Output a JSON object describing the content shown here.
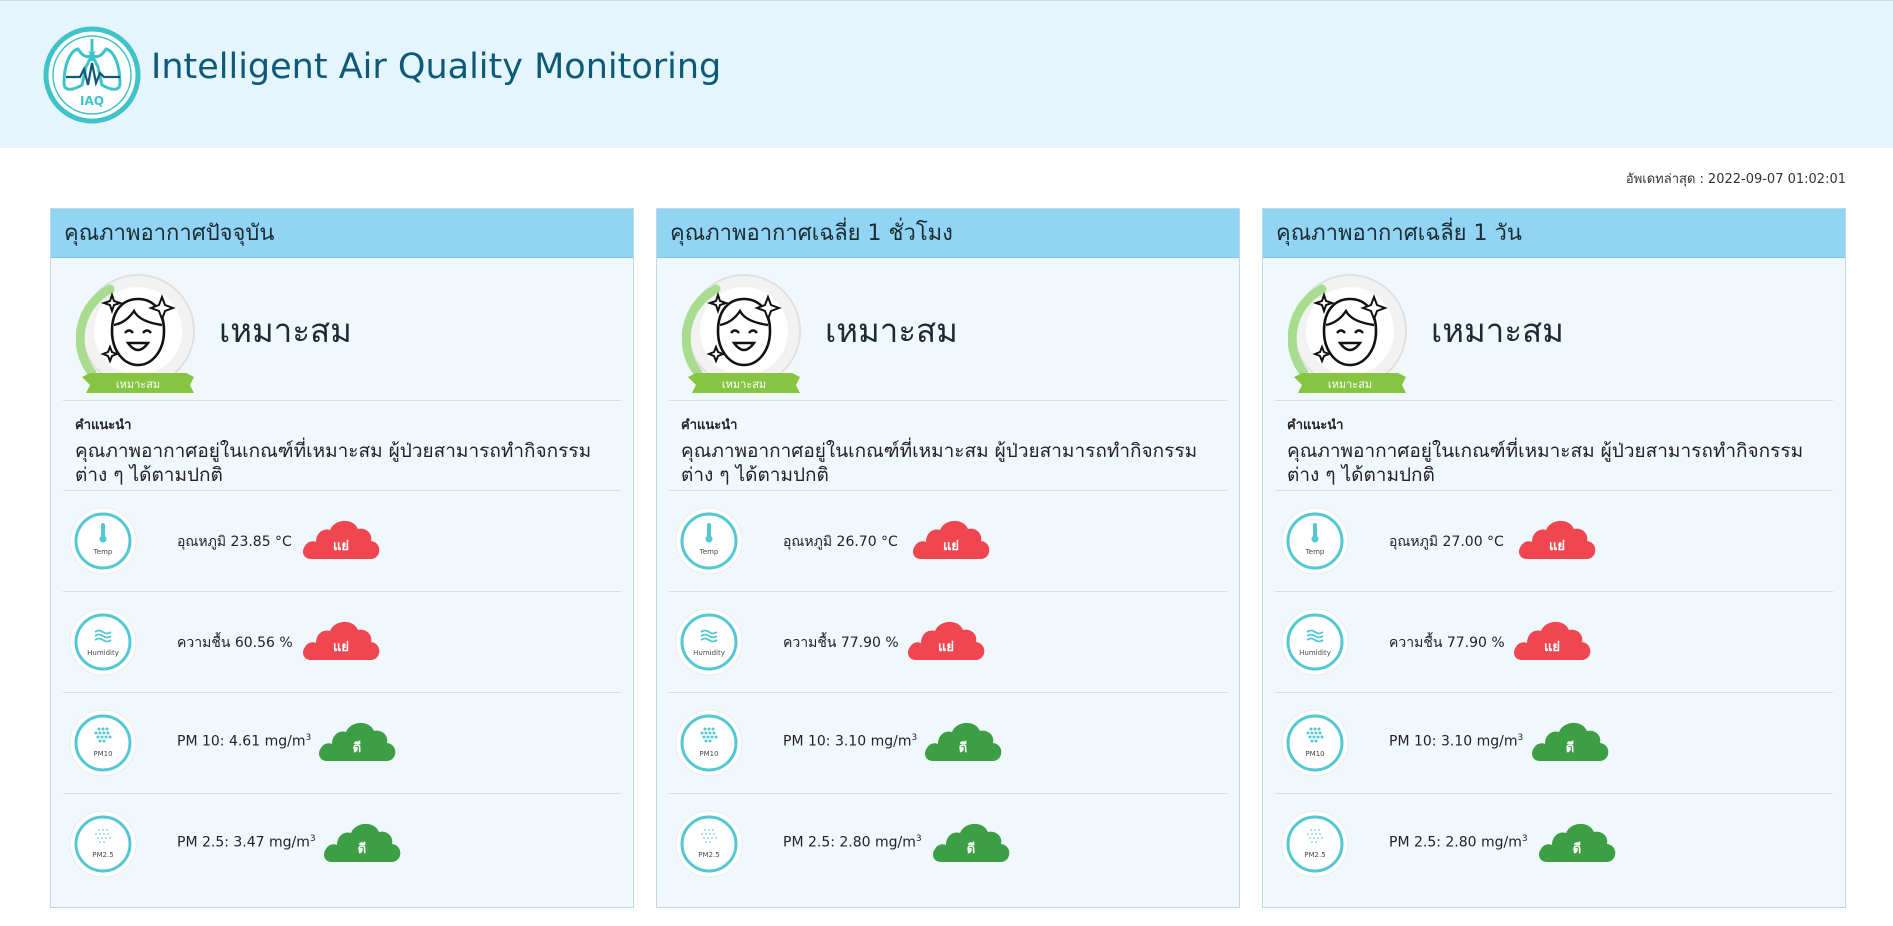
{
  "header": {
    "title": "Intelligent Air Quality Monitoring",
    "logo_text": "IAQ"
  },
  "last_updated": {
    "label": "อัพเดทล่าสุด :",
    "value": "2022-09-07 01:02:01"
  },
  "colors": {
    "header_bg": "#e4f5fd",
    "title": "#0c5a78",
    "panel_head": "#92d4f4",
    "good_green": "#3c9f44",
    "bad_red": "#ef4650",
    "ribbon_green": "#86c541",
    "icon_teal": "#53c8d3"
  },
  "panels": [
    {
      "title": "คุณภาพอากาศปัจจุบัน",
      "status": "เหมาะสม",
      "ribbon": "เหมาะสม",
      "advice_label": "คำแนะนำ",
      "advice_line1": "คุณภาพอากาศอยู่ในเกณฑ์ที่เหมาะสม ผู้ป่วยสามารถทำกิจกรรม",
      "advice_line2": "ต่าง ๆ ได้ตามปกติ",
      "metrics": [
        {
          "icon": "thermometer-icon",
          "icon_label": "Temp",
          "label": "อุณหภูมิ 23.85 °C",
          "sup": "",
          "rating": "แย่",
          "rating_color": "#ef4650"
        },
        {
          "icon": "humidity-icon",
          "icon_label": "Humidity",
          "label": "ความชื้น 60.56 %",
          "sup": "",
          "rating": "แย่",
          "rating_color": "#ef4650"
        },
        {
          "icon": "pm10-icon",
          "icon_label": "PM10",
          "label": "PM 10: 4.61 mg/m",
          "sup": "3",
          "rating": "ดี",
          "rating_color": "#3c9f44"
        },
        {
          "icon": "pm25-icon",
          "icon_label": "PM2.5",
          "label": "PM 2.5: 3.47 mg/m",
          "sup": "3",
          "rating": "ดี",
          "rating_color": "#3c9f44"
        }
      ]
    },
    {
      "title": "คุณภาพอากาศเฉลี่ย 1 ชั่วโมง",
      "status": "เหมาะสม",
      "ribbon": "เหมาะสม",
      "advice_label": "คำแนะนำ",
      "advice_line1": "คุณภาพอากาศอยู่ในเกณฑ์ที่เหมาะสม ผู้ป่วยสามารถทำกิจกรรม",
      "advice_line2": "ต่าง ๆ ได้ตามปกติ",
      "metrics": [
        {
          "icon": "thermometer-icon",
          "icon_label": "Temp",
          "label": "อุณหภูมิ 26.70 °C",
          "sup": "",
          "rating": "แย่",
          "rating_color": "#ef4650"
        },
        {
          "icon": "humidity-icon",
          "icon_label": "Humidity",
          "label": "ความชื้น 77.90 %",
          "sup": "",
          "rating": "แย่",
          "rating_color": "#ef4650"
        },
        {
          "icon": "pm10-icon",
          "icon_label": "PM10",
          "label": "PM 10: 3.10 mg/m",
          "sup": "3",
          "rating": "ดี",
          "rating_color": "#3c9f44"
        },
        {
          "icon": "pm25-icon",
          "icon_label": "PM2.5",
          "label": "PM 2.5: 2.80 mg/m",
          "sup": "3",
          "rating": "ดี",
          "rating_color": "#3c9f44"
        }
      ]
    },
    {
      "title": "คุณภาพอากาศเฉลี่ย 1 วัน",
      "status": "เหมาะสม",
      "ribbon": "เหมาะสม",
      "advice_label": "คำแนะนำ",
      "advice_line1": "คุณภาพอากาศอยู่ในเกณฑ์ที่เหมาะสม ผู้ป่วยสามารถทำกิจกรรม",
      "advice_line2": "ต่าง ๆ ได้ตามปกติ",
      "metrics": [
        {
          "icon": "thermometer-icon",
          "icon_label": "Temp",
          "label": "อุณหภูมิ 27.00 °C",
          "sup": "",
          "rating": "แย่",
          "rating_color": "#ef4650"
        },
        {
          "icon": "humidity-icon",
          "icon_label": "Humidity",
          "label": "ความชื้น 77.90 %",
          "sup": "",
          "rating": "แย่",
          "rating_color": "#ef4650"
        },
        {
          "icon": "pm10-icon",
          "icon_label": "PM10",
          "label": "PM 10: 3.10 mg/m",
          "sup": "3",
          "rating": "ดี",
          "rating_color": "#3c9f44"
        },
        {
          "icon": "pm25-icon",
          "icon_label": "PM2.5",
          "label": "PM 2.5: 2.80 mg/m",
          "sup": "3",
          "rating": "ดี",
          "rating_color": "#3c9f44"
        }
      ]
    }
  ]
}
